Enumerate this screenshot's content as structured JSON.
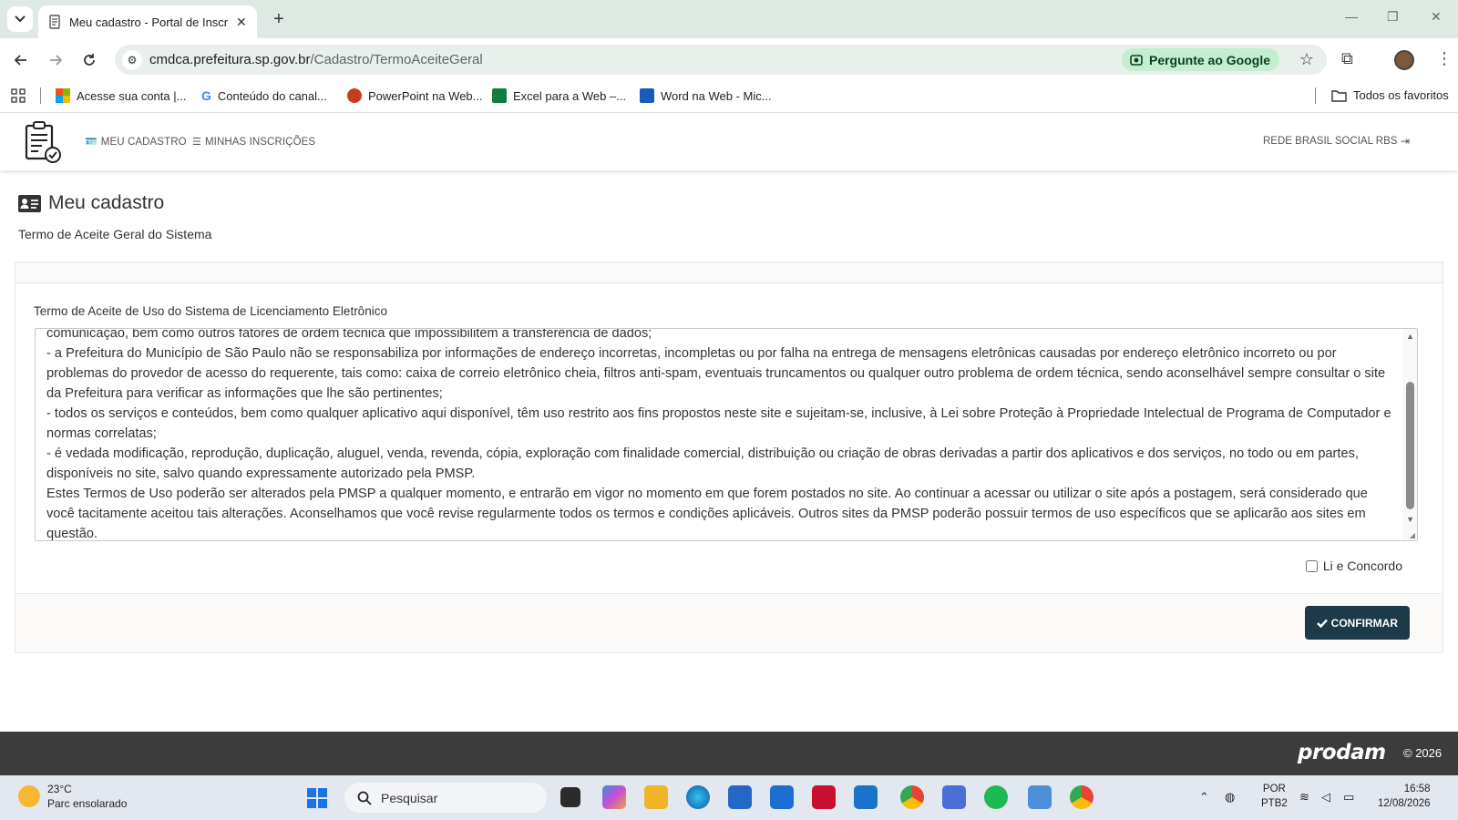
{
  "browser": {
    "tab_title": "Meu cadastro - Portal de Inscriç",
    "url_host": "cmdca.prefeitura.sp.gov.br",
    "url_path": "/Cadastro/TermoAceiteGeral",
    "ask_google": "Pergunte ao Google",
    "bookmarks": [
      {
        "label": "Acesse sua conta |..."
      },
      {
        "label": "Conteúdo do canal..."
      },
      {
        "label": "PowerPoint na Web..."
      },
      {
        "label": "Excel para a Web –..."
      },
      {
        "label": "Word na Web - Mic..."
      }
    ],
    "all_bookmarks": "Todos os favoritos"
  },
  "header": {
    "menu_cadastro": "MEU CADASTRO",
    "menu_inscricoes": "MINHAS INSCRIÇÕES",
    "user": "REDE BRASIL SOCIAL RBS"
  },
  "page": {
    "title": "Meu cadastro",
    "subtitle": "Termo de Aceite Geral do Sistema",
    "field_label": "Termo de Aceite de Uso do Sistema de Licenciamento Eletrônico",
    "terms": [
      "- a Prefeitura do Município de São Paulo (PMSP) não se responsabiliza por requerimentos via Internet não recebidos por motivo de ordem técnica dos computadores, falhas de comunicação, congestionamento das linhas de comunicação, bem como outros fatores de ordem técnica que impossibilitem a transferência de dados;",
      "- a Prefeitura do Município de São Paulo não se responsabiliza por informações de endereço incorretas, incompletas ou por falha na entrega de mensagens eletrônicas causadas por endereço eletrônico incorreto ou por problemas do provedor de acesso do requerente, tais como: caixa de correio eletrônico cheia, filtros anti-spam, eventuais truncamentos ou qualquer outro problema de ordem técnica, sendo aconselhável sempre consultar o site da Prefeitura para verificar as informações que lhe são pertinentes;",
      "- todos os serviços e conteúdos, bem como qualquer aplicativo aqui disponível, têm uso restrito aos fins propostos neste site e sujeitam-se, inclusive, à Lei sobre Proteção à Propriedade Intelectual de Programa de Computador e normas correlatas;",
      "- é vedada modificação, reprodução, duplicação, aluguel, venda, revenda, cópia, exploração com finalidade comercial, distribuição ou criação de obras derivadas a partir dos aplicativos e dos serviços, no todo ou em partes, disponíveis no site, salvo quando expressamente autorizado pela PMSP.",
      "Estes Termos de Uso poderão ser alterados pela PMSP a qualquer momento, e entrarão em vigor no momento em que forem postados no site. Ao continuar a acessar ou utilizar o site após a postagem, será considerado que você tacitamente aceitou tais alterações. Aconselhamos que você revise regularmente todos os termos e condições aplicáveis. Outros sites da PMSP poderão possuir termos de uso específicos que se aplicarão aos sites em questão."
    ],
    "agree_label": "Li e Concordo",
    "confirm_label": "CONFIRMAR"
  },
  "footer": {
    "brand": "prodam",
    "copyright": "© 2026"
  },
  "taskbar": {
    "temp": "23°C",
    "weather": "Parc ensolarado",
    "search_placeholder": "Pesquisar",
    "lang1": "POR",
    "lang2": "PTB2",
    "time": "16:58",
    "date": "12/08/2026"
  }
}
